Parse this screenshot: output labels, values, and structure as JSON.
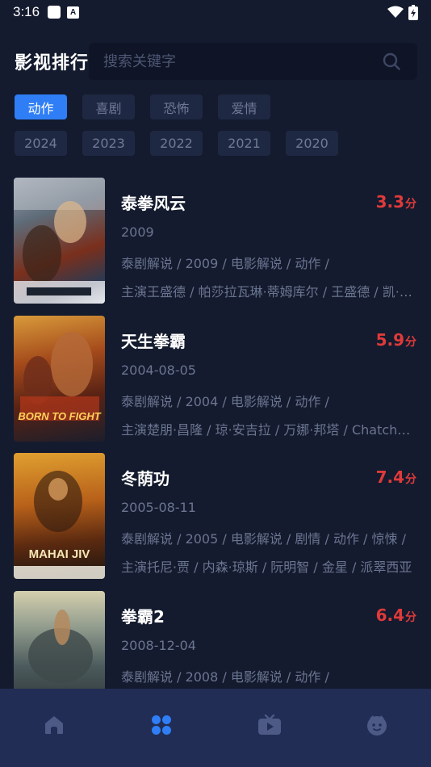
{
  "status_bar": {
    "time": "3:16",
    "notif_letter": "A"
  },
  "header": {
    "title": "影视排行"
  },
  "search": {
    "placeholder": "搜索关键字",
    "value": ""
  },
  "genres": [
    {
      "label": "动作",
      "active": true
    },
    {
      "label": "喜剧",
      "active": false
    },
    {
      "label": "恐怖",
      "active": false
    },
    {
      "label": "爱情",
      "active": false
    }
  ],
  "years": [
    {
      "label": "2024"
    },
    {
      "label": "2023"
    },
    {
      "label": "2022"
    },
    {
      "label": "2021"
    },
    {
      "label": "2020"
    }
  ],
  "movies": [
    {
      "title": "泰拳风云",
      "rating": "3.3",
      "rating_unit": "分",
      "date": "2009",
      "tags": "泰剧解说 / 2009 / 电影解说 / 动作 /",
      "cast": "主演王盛德 / 帕莎拉瓦琳·蒂姆库尔 / 王盛德 / 凯·瓦拉瓦特"
    },
    {
      "title": "天生拳霸",
      "rating": "5.9",
      "rating_unit": "分",
      "date": "2004-08-05",
      "tags": "泰剧解说 / 2004 / 电影解说 / 动作 /",
      "cast": "主演楚朋·昌隆 / 琼·安吉拉 / 万娜·邦塔 / Chatchai Plengpanich",
      "poster_text": "BORN TO FIGHT"
    },
    {
      "title": "冬荫功",
      "rating": "7.4",
      "rating_unit": "分",
      "date": "2005-08-11",
      "tags": "泰剧解说 / 2005 / 电影解说 / 剧情 / 动作 / 惊悚 /",
      "cast": "主演托尼·贾 / 内森·琼斯 / 阮明智 / 金星 / 派翠西亚",
      "poster_text": "MAHAI JIV"
    },
    {
      "title": "拳霸2",
      "rating": "6.4",
      "rating_unit": "分",
      "date": "2008-12-04",
      "tags": "泰剧解说 / 2008 / 电影解说 / 动作 /",
      "cast": ""
    }
  ],
  "bottom_nav": [
    {
      "icon": "home-icon",
      "active": false
    },
    {
      "icon": "category-icon",
      "active": true
    },
    {
      "icon": "tv-icon",
      "active": false
    },
    {
      "icon": "profile-face-icon",
      "active": false
    }
  ],
  "colors": {
    "background": "#141b2e",
    "accent": "#2f7ef5",
    "rating": "#e03a3a",
    "nav_bg": "#212d55",
    "muted": "#6b7591"
  }
}
